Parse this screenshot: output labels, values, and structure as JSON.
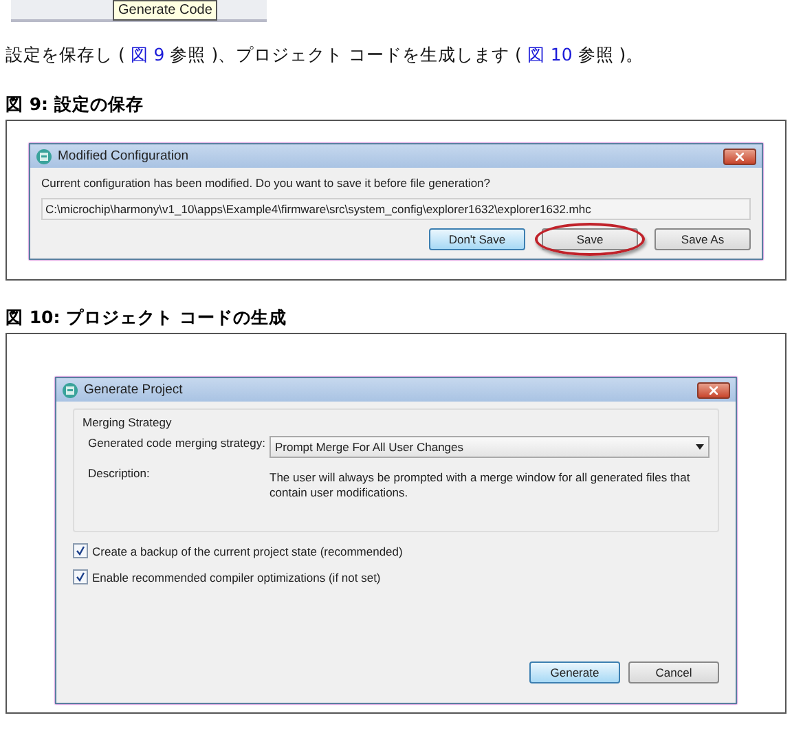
{
  "top_tooltip": "Generate Code",
  "intro": [
    {
      "kind": "text",
      "text": "設定を保存し ( "
    },
    {
      "kind": "link",
      "text": "図 9"
    },
    {
      "kind": "text",
      "text": " 参照 )、プロジェクト コードを生成します ( "
    },
    {
      "kind": "link",
      "text": "図 10"
    },
    {
      "kind": "text",
      "text": " 参照 )。"
    }
  ],
  "figure_9": {
    "caption": "図 9:  設定の保存",
    "dialog": {
      "title": "Modified Configuration",
      "message": "Current configuration has been modified.  Do you want to save it before file generation?",
      "path": "C:\\microchip\\harmony\\v1_10\\apps\\Example4\\firmware\\src\\system_config\\explorer1632\\explorer1632.mhc",
      "buttons": [
        {
          "label": "Don't Save",
          "focused": true,
          "circled": false
        },
        {
          "label": "Save",
          "focused": false,
          "circled": true
        },
        {
          "label": "Save As",
          "focused": false,
          "circled": false
        }
      ]
    }
  },
  "figure_10": {
    "caption": "図 10:  プロジェクト コードの生成",
    "dialog": {
      "title": "Generate Project",
      "group_title": "Merging Strategy",
      "strategy_label": "Generated code merging strategy:",
      "strategy_value": "Prompt Merge For All User Changes",
      "description_label": "Description:",
      "description": "The user will always be prompted with a merge window for all generated files that contain user modifications.",
      "options": [
        {
          "label": "Create a backup of the current project state (recommended)",
          "checked": true
        },
        {
          "label": "Enable recommended compiler optimizations (if not set)",
          "checked": true
        }
      ],
      "buttons": [
        {
          "label": "Generate",
          "focused": true,
          "circled": false
        },
        {
          "label": "Cancel",
          "focused": false,
          "circled": false
        }
      ]
    }
  }
}
